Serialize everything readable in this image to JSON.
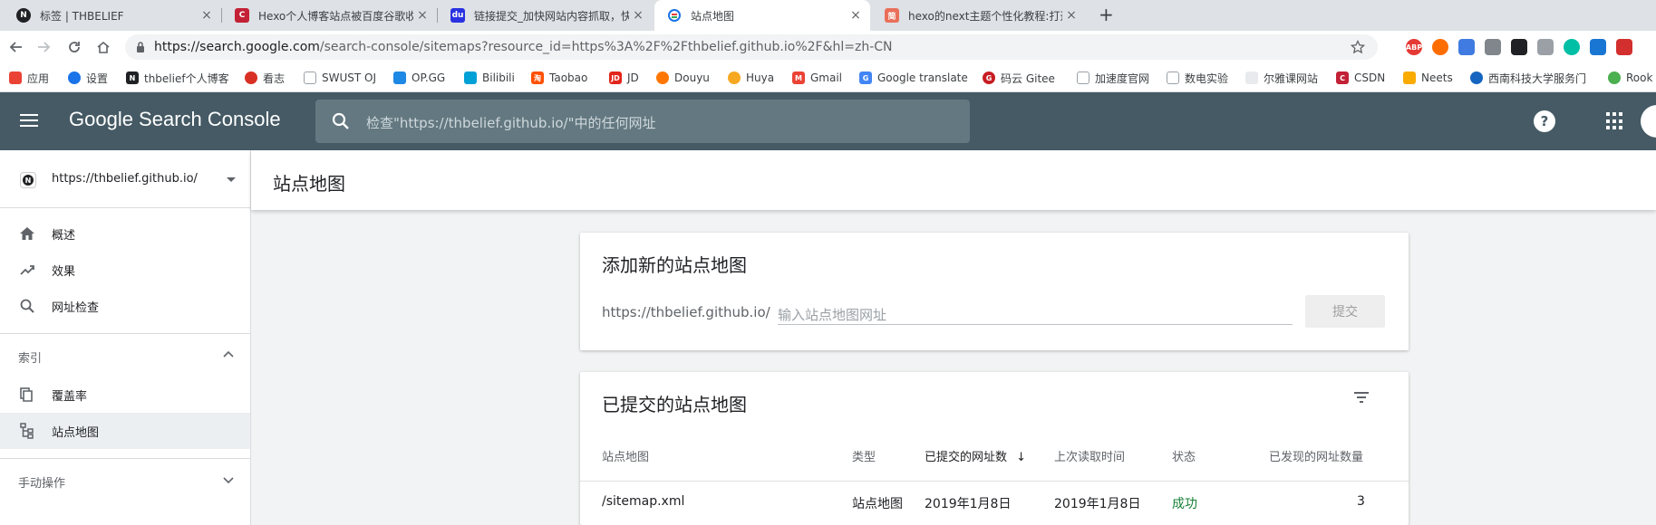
{
  "browser": {
    "tabs": [
      {
        "title": "标签 | THBELIEF",
        "favicon": "notion-icon",
        "active": false
      },
      {
        "title": "Hexo个人博客站点被百度谷歌收",
        "favicon": "csdn-icon",
        "active": false
      },
      {
        "title": "链接提交_加快网站内容抓取，快",
        "favicon": "baidu-icon",
        "active": false
      },
      {
        "title": "站点地图",
        "favicon": "search-console-icon",
        "active": true
      },
      {
        "title": "hexo的next主题个性化教程:打造",
        "favicon": "jianshu-icon",
        "active": false
      }
    ],
    "new_tab_symbol": "+",
    "close_symbol": "×",
    "url_host": "https://search.google.com",
    "url_path": "/search-console/sitemaps?resource_id=https%3A%2F%2Fthbelief.github.io%2F&hl=zh-CN",
    "extensions": [
      "ABP"
    ],
    "bookmarks": [
      {
        "label": "应用",
        "icon": "apps-icon",
        "color": "#ea4335"
      },
      {
        "label": "设置",
        "icon": "gear-icon",
        "color": "#1a73e8"
      },
      {
        "label": "thbelief个人博客",
        "icon": "notion-icon",
        "color": "#202124"
      },
      {
        "label": "看志",
        "icon": "flower-icon",
        "color": "#d93025"
      },
      {
        "label": "SWUST OJ",
        "icon": "page-icon",
        "color": "#ffffff"
      },
      {
        "label": "OP.GG",
        "icon": "opgg-icon",
        "color": "#1e88e5"
      },
      {
        "label": "Bilibili",
        "icon": "bilibili-icon",
        "color": "#00a1d6"
      },
      {
        "label": "Taobao",
        "icon": "taobao-icon",
        "color": "#ff5000"
      },
      {
        "label": "JD",
        "icon": "jd-icon",
        "color": "#e1251b"
      },
      {
        "label": "Douyu",
        "icon": "douyu-icon",
        "color": "#ff7700"
      },
      {
        "label": "Huya",
        "icon": "huya-icon",
        "color": "#f6a821"
      },
      {
        "label": "Gmail",
        "icon": "gmail-icon",
        "color": "#ea4335"
      },
      {
        "label": "Google translate",
        "icon": "translate-icon",
        "color": "#4285f4"
      },
      {
        "label": "码云 Gitee",
        "icon": "gitee-icon",
        "color": "#c71d23"
      },
      {
        "label": "加速度官网",
        "icon": "page-icon",
        "color": "#ffffff"
      },
      {
        "label": "数电实验",
        "icon": "page-icon",
        "color": "#ffffff"
      },
      {
        "label": "尔雅课网站",
        "icon": "erya-icon",
        "color": "#e8eaed"
      },
      {
        "label": "CSDN",
        "icon": "csdn-icon",
        "color": "#c32136"
      },
      {
        "label": "Neets",
        "icon": "neets-icon",
        "color": "#f9ab00"
      },
      {
        "label": "西南科技大学服务门",
        "icon": "swust-icon",
        "color": "#1565c0"
      },
      {
        "label": "Rook",
        "icon": "rook-icon",
        "color": "#4caf50"
      }
    ]
  },
  "gsc": {
    "title": "Google Search Console",
    "search_placeholder": "检查\"https://thbelief.github.io/\"中的任何网址",
    "help_symbol": "?"
  },
  "sidebar": {
    "property": "https://thbelief.github.io/",
    "items": [
      {
        "label": "概述",
        "icon": "home-icon"
      },
      {
        "label": "效果",
        "icon": "trending-up-icon"
      },
      {
        "label": "网址检查",
        "icon": "search-icon"
      }
    ],
    "sections": [
      {
        "label": "索引",
        "expanded": true
      },
      {
        "label": "手动操作",
        "expanded": false
      }
    ],
    "index_items": [
      {
        "label": "覆盖率",
        "icon": "copy-icon",
        "active": false
      },
      {
        "label": "站点地图",
        "icon": "sitemap-icon",
        "active": true
      }
    ]
  },
  "main": {
    "page_title": "站点地图",
    "add_card": {
      "title": "添加新的站点地图",
      "prefix": "https://thbelief.github.io/",
      "input_placeholder": "输入站点地图网址",
      "submit_label": "提交"
    },
    "list_card": {
      "title": "已提交的站点地图",
      "columns": [
        "站点地图",
        "类型",
        "已提交的网址数",
        "上次读取时间",
        "状态",
        "已发现的网址数量"
      ],
      "sort_symbol": "↓",
      "rows": [
        {
          "sitemap": "/sitemap.xml",
          "type": "站点地图",
          "submitted": "2019年1月8日",
          "last_read": "2019年1月8日",
          "status": "成功",
          "discovered": "3"
        }
      ]
    }
  },
  "colors": {
    "header_bg": "#455a64",
    "success": "#188038",
    "active_nav": "#eceff1"
  }
}
